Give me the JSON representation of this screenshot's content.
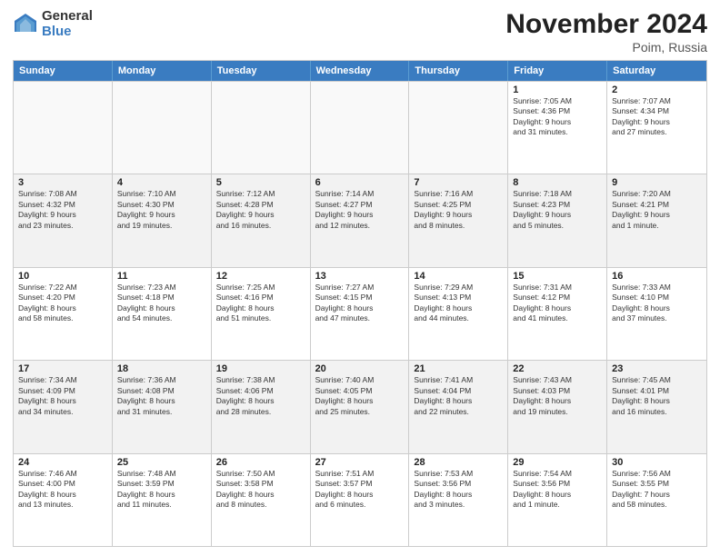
{
  "header": {
    "logo_general": "General",
    "logo_blue": "Blue",
    "month_title": "November 2024",
    "location": "Poim, Russia"
  },
  "weekdays": [
    "Sunday",
    "Monday",
    "Tuesday",
    "Wednesday",
    "Thursday",
    "Friday",
    "Saturday"
  ],
  "rows": [
    [
      {
        "day": "",
        "info": ""
      },
      {
        "day": "",
        "info": ""
      },
      {
        "day": "",
        "info": ""
      },
      {
        "day": "",
        "info": ""
      },
      {
        "day": "",
        "info": ""
      },
      {
        "day": "1",
        "info": "Sunrise: 7:05 AM\nSunset: 4:36 PM\nDaylight: 9 hours\nand 31 minutes."
      },
      {
        "day": "2",
        "info": "Sunrise: 7:07 AM\nSunset: 4:34 PM\nDaylight: 9 hours\nand 27 minutes."
      }
    ],
    [
      {
        "day": "3",
        "info": "Sunrise: 7:08 AM\nSunset: 4:32 PM\nDaylight: 9 hours\nand 23 minutes."
      },
      {
        "day": "4",
        "info": "Sunrise: 7:10 AM\nSunset: 4:30 PM\nDaylight: 9 hours\nand 19 minutes."
      },
      {
        "day": "5",
        "info": "Sunrise: 7:12 AM\nSunset: 4:28 PM\nDaylight: 9 hours\nand 16 minutes."
      },
      {
        "day": "6",
        "info": "Sunrise: 7:14 AM\nSunset: 4:27 PM\nDaylight: 9 hours\nand 12 minutes."
      },
      {
        "day": "7",
        "info": "Sunrise: 7:16 AM\nSunset: 4:25 PM\nDaylight: 9 hours\nand 8 minutes."
      },
      {
        "day": "8",
        "info": "Sunrise: 7:18 AM\nSunset: 4:23 PM\nDaylight: 9 hours\nand 5 minutes."
      },
      {
        "day": "9",
        "info": "Sunrise: 7:20 AM\nSunset: 4:21 PM\nDaylight: 9 hours\nand 1 minute."
      }
    ],
    [
      {
        "day": "10",
        "info": "Sunrise: 7:22 AM\nSunset: 4:20 PM\nDaylight: 8 hours\nand 58 minutes."
      },
      {
        "day": "11",
        "info": "Sunrise: 7:23 AM\nSunset: 4:18 PM\nDaylight: 8 hours\nand 54 minutes."
      },
      {
        "day": "12",
        "info": "Sunrise: 7:25 AM\nSunset: 4:16 PM\nDaylight: 8 hours\nand 51 minutes."
      },
      {
        "day": "13",
        "info": "Sunrise: 7:27 AM\nSunset: 4:15 PM\nDaylight: 8 hours\nand 47 minutes."
      },
      {
        "day": "14",
        "info": "Sunrise: 7:29 AM\nSunset: 4:13 PM\nDaylight: 8 hours\nand 44 minutes."
      },
      {
        "day": "15",
        "info": "Sunrise: 7:31 AM\nSunset: 4:12 PM\nDaylight: 8 hours\nand 41 minutes."
      },
      {
        "day": "16",
        "info": "Sunrise: 7:33 AM\nSunset: 4:10 PM\nDaylight: 8 hours\nand 37 minutes."
      }
    ],
    [
      {
        "day": "17",
        "info": "Sunrise: 7:34 AM\nSunset: 4:09 PM\nDaylight: 8 hours\nand 34 minutes."
      },
      {
        "day": "18",
        "info": "Sunrise: 7:36 AM\nSunset: 4:08 PM\nDaylight: 8 hours\nand 31 minutes."
      },
      {
        "day": "19",
        "info": "Sunrise: 7:38 AM\nSunset: 4:06 PM\nDaylight: 8 hours\nand 28 minutes."
      },
      {
        "day": "20",
        "info": "Sunrise: 7:40 AM\nSunset: 4:05 PM\nDaylight: 8 hours\nand 25 minutes."
      },
      {
        "day": "21",
        "info": "Sunrise: 7:41 AM\nSunset: 4:04 PM\nDaylight: 8 hours\nand 22 minutes."
      },
      {
        "day": "22",
        "info": "Sunrise: 7:43 AM\nSunset: 4:03 PM\nDaylight: 8 hours\nand 19 minutes."
      },
      {
        "day": "23",
        "info": "Sunrise: 7:45 AM\nSunset: 4:01 PM\nDaylight: 8 hours\nand 16 minutes."
      }
    ],
    [
      {
        "day": "24",
        "info": "Sunrise: 7:46 AM\nSunset: 4:00 PM\nDaylight: 8 hours\nand 13 minutes."
      },
      {
        "day": "25",
        "info": "Sunrise: 7:48 AM\nSunset: 3:59 PM\nDaylight: 8 hours\nand 11 minutes."
      },
      {
        "day": "26",
        "info": "Sunrise: 7:50 AM\nSunset: 3:58 PM\nDaylight: 8 hours\nand 8 minutes."
      },
      {
        "day": "27",
        "info": "Sunrise: 7:51 AM\nSunset: 3:57 PM\nDaylight: 8 hours\nand 6 minutes."
      },
      {
        "day": "28",
        "info": "Sunrise: 7:53 AM\nSunset: 3:56 PM\nDaylight: 8 hours\nand 3 minutes."
      },
      {
        "day": "29",
        "info": "Sunrise: 7:54 AM\nSunset: 3:56 PM\nDaylight: 8 hours\nand 1 minute."
      },
      {
        "day": "30",
        "info": "Sunrise: 7:56 AM\nSunset: 3:55 PM\nDaylight: 7 hours\nand 58 minutes."
      }
    ]
  ]
}
